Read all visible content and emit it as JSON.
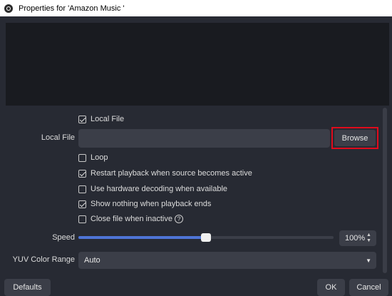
{
  "window": {
    "title": "Properties for 'Amazon Music '"
  },
  "options": {
    "local_file_toggle": {
      "label": "Local File",
      "checked": true
    },
    "local_file_label": "Local File",
    "local_file_value": "",
    "browse_label": "Browse",
    "loop": {
      "label": "Loop",
      "checked": false
    },
    "restart": {
      "label": "Restart playback when source becomes active",
      "checked": true
    },
    "hw_decoding": {
      "label": "Use hardware decoding when available",
      "checked": false
    },
    "show_nothing": {
      "label": "Show nothing when playback ends",
      "checked": true
    },
    "close_inactive": {
      "label": "Close file when inactive",
      "checked": false,
      "help_glyph": "?"
    },
    "speed_label": "Speed",
    "speed_value": "100%",
    "speed_fraction": 0.5,
    "yuv_label": "YUV Color Range",
    "yuv_value": "Auto"
  },
  "footer": {
    "defaults_label": "Defaults",
    "ok_label": "OK",
    "cancel_label": "Cancel"
  },
  "colors": {
    "highlight": "#e00b1c",
    "slider_fill": "#4e74d6",
    "background": "#272a33"
  },
  "icons": {
    "app": "obs-icon",
    "help": "help-circle-icon",
    "spin": "spin-arrows-icon",
    "dropdown": "chevron-down-icon"
  }
}
